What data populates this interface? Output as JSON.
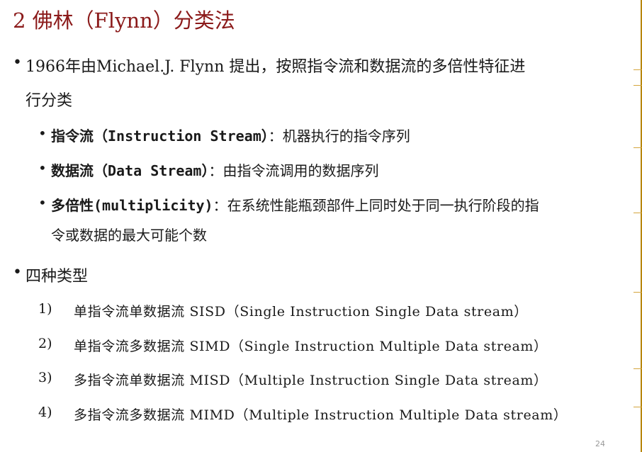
{
  "title": "2 佛林（Flynn）分类法",
  "bullet1": {
    "line1": "1966年由Michael.J. Flynn 提出，按照指令流和数据流的多倍性特征进",
    "line2": "行分类",
    "subitems": [
      {
        "term": "指令流（Instruction Stream）",
        "desc": "：机器执行的指令序列"
      },
      {
        "term": "数据流（Data Stream）",
        "desc": "：由指令流调用的数据序列"
      },
      {
        "term": "多倍性(multiplicity)",
        "desc": "：在系统性能瓶颈部件上同时处于同一执行阶段的指",
        "desc2": "令或数据的最大可能个数"
      }
    ]
  },
  "bullet2": {
    "label": "四种类型",
    "items": [
      {
        "num": "1)",
        "text": "单指令流单数据流 SISD（Single Instruction Single Data stream）"
      },
      {
        "num": "2)",
        "text": "单指令流多数据流 SIMD（Single Instruction Multiple Data stream）"
      },
      {
        "num": "3)",
        "text": "多指令流单数据流 MISD（Multiple Instruction Single Data stream）"
      },
      {
        "num": "4)",
        "text": "多指令流多数据流 MIMD（Multiple Instruction Multiple Data stream）"
      }
    ]
  },
  "page_number": "24",
  "colors": {
    "title": "#8b1a1a",
    "accent_line": "#b8860b"
  }
}
